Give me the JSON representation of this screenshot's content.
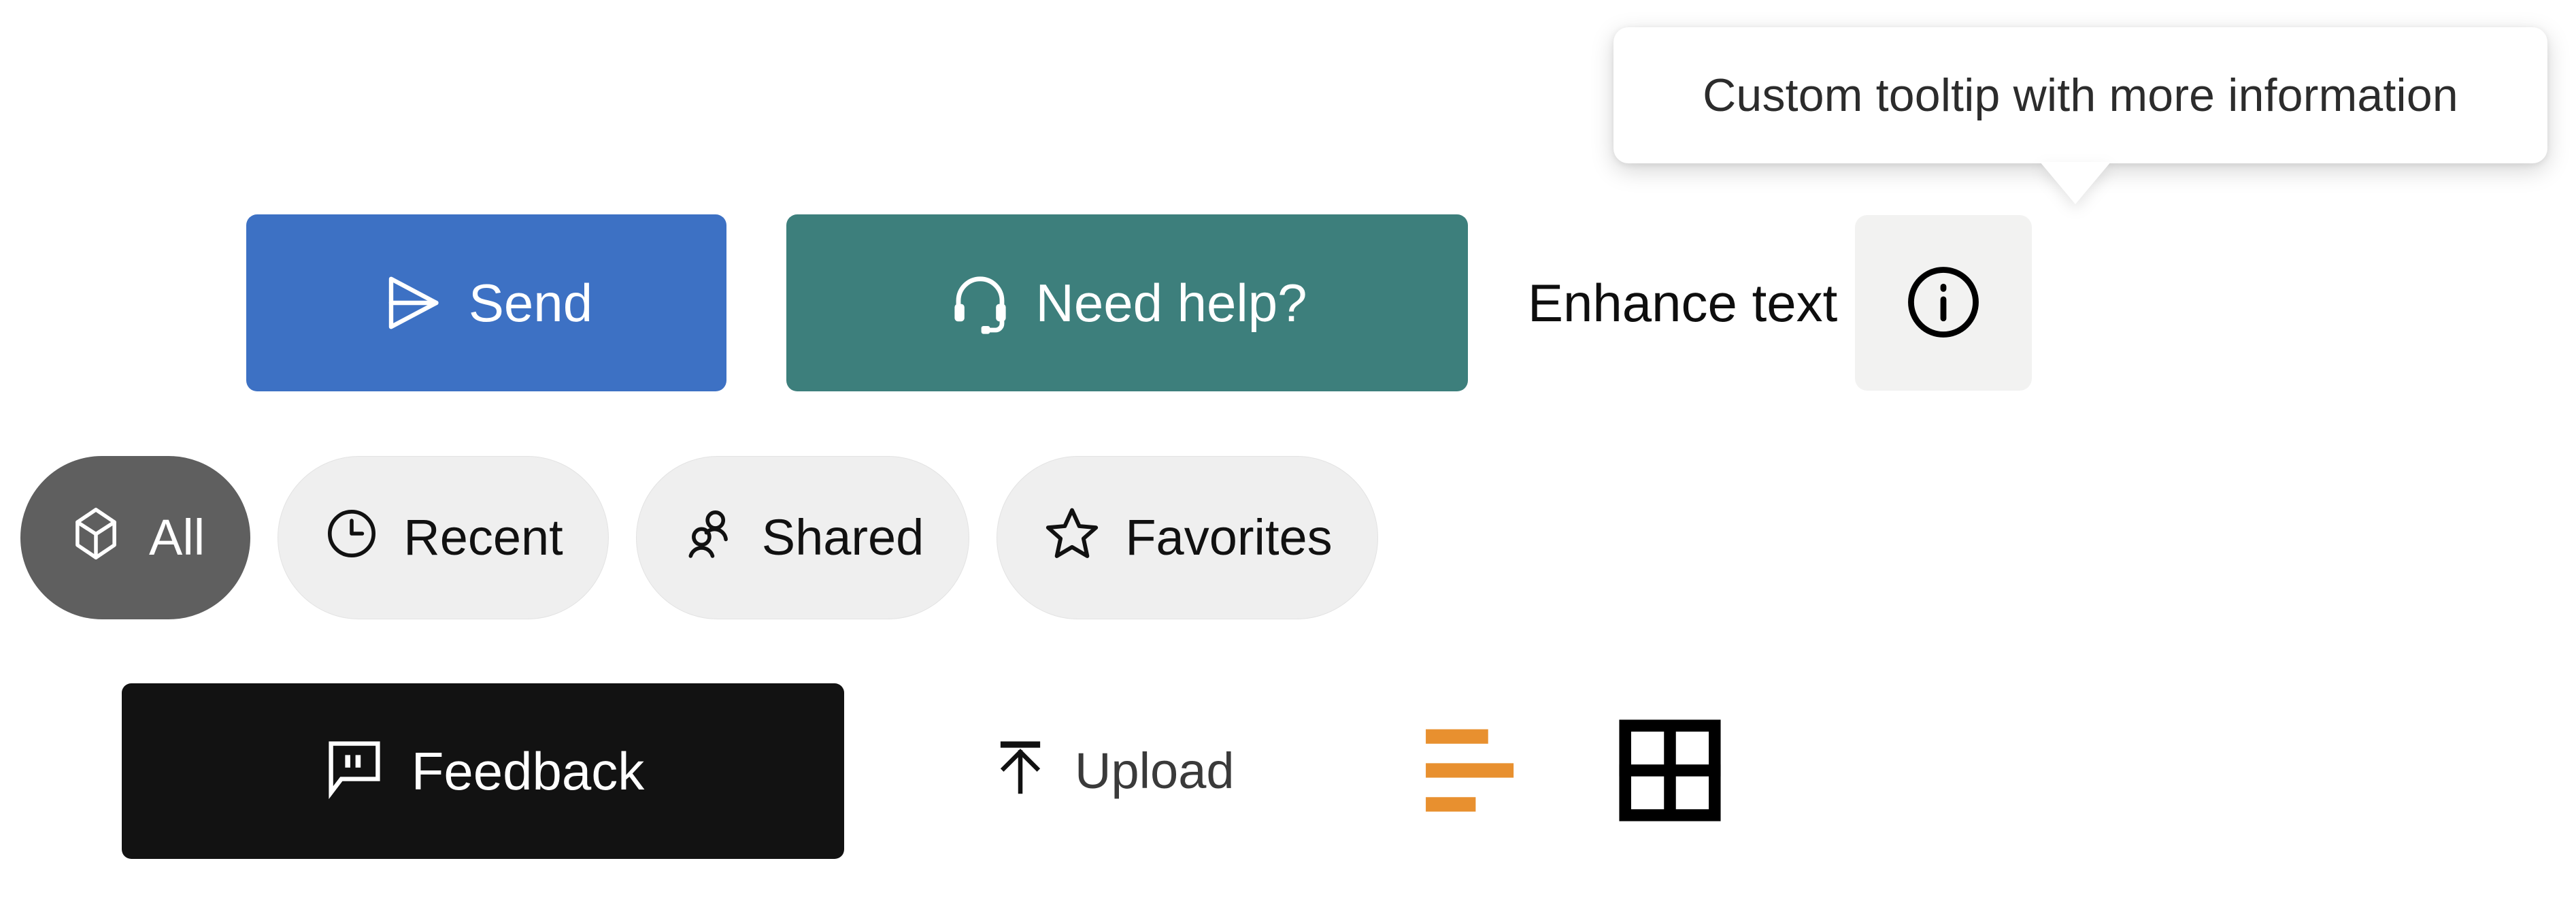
{
  "tooltip": {
    "text": "Custom tooltip with more information",
    "anchor": "info-button",
    "placement": "top"
  },
  "actions": {
    "send": {
      "label": "Send",
      "icon": "paper-plane-icon",
      "background": "#3d71c4",
      "text_color": "#ffffff"
    },
    "help": {
      "label": "Need help?",
      "icon": "headset-icon",
      "background": "#3d7f7c",
      "text_color": "#ffffff"
    },
    "enhance": {
      "label": "Enhance text",
      "info_icon": "info-circle-icon",
      "info_background": "#f2f2f1"
    }
  },
  "filters": {
    "selected": "All",
    "active_background": "#5f5f5f",
    "idle_background": "#efefef",
    "items": [
      {
        "label": "All",
        "icon": "cube-icon",
        "selected": true
      },
      {
        "label": "Recent",
        "icon": "clock-icon",
        "selected": false
      },
      {
        "label": "Shared",
        "icon": "people-icon",
        "selected": false
      },
      {
        "label": "Favorites",
        "icon": "star-icon",
        "selected": false
      }
    ]
  },
  "utilities": {
    "feedback": {
      "label": "Feedback",
      "icon": "chat-quote-icon",
      "background": "#121212",
      "text_color": "#ffffff"
    },
    "upload": {
      "label": "Upload",
      "icon": "arrow-up-to-line-icon",
      "text_color": "#3a3a3a"
    },
    "list_view": {
      "icon": "list-lines-icon",
      "color": "#e8902f"
    },
    "grid_view": {
      "icon": "grid-2x2-icon",
      "color": "#000000"
    }
  }
}
